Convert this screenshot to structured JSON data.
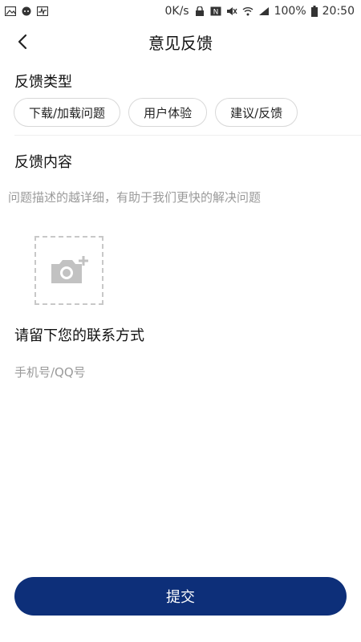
{
  "status_bar": {
    "left_icons": [
      "image-icon",
      "chat-icon",
      "activity-icon"
    ],
    "net_speed": "0K/s",
    "right_icons": [
      "nfc-icon",
      "mute-icon",
      "wifi-icon",
      "signal-icon"
    ],
    "battery_percent": "100%",
    "time": "20:50"
  },
  "header": {
    "title": "意见反馈",
    "back_icon": "chevron-left-icon"
  },
  "feedback_type": {
    "label": "反馈类型",
    "options": [
      "下载/加载问题",
      "用户体验",
      "建议/反馈"
    ]
  },
  "feedback_content": {
    "label": "反馈内容",
    "placeholder": "问题描述的越详细，有助于我们更快的解决问题",
    "upload_icon": "camera-add-icon"
  },
  "contact": {
    "label": "请留下您的联系方式",
    "placeholder": "手机号/QQ号"
  },
  "submit": {
    "label": "提交",
    "color": "#0d2f79"
  }
}
